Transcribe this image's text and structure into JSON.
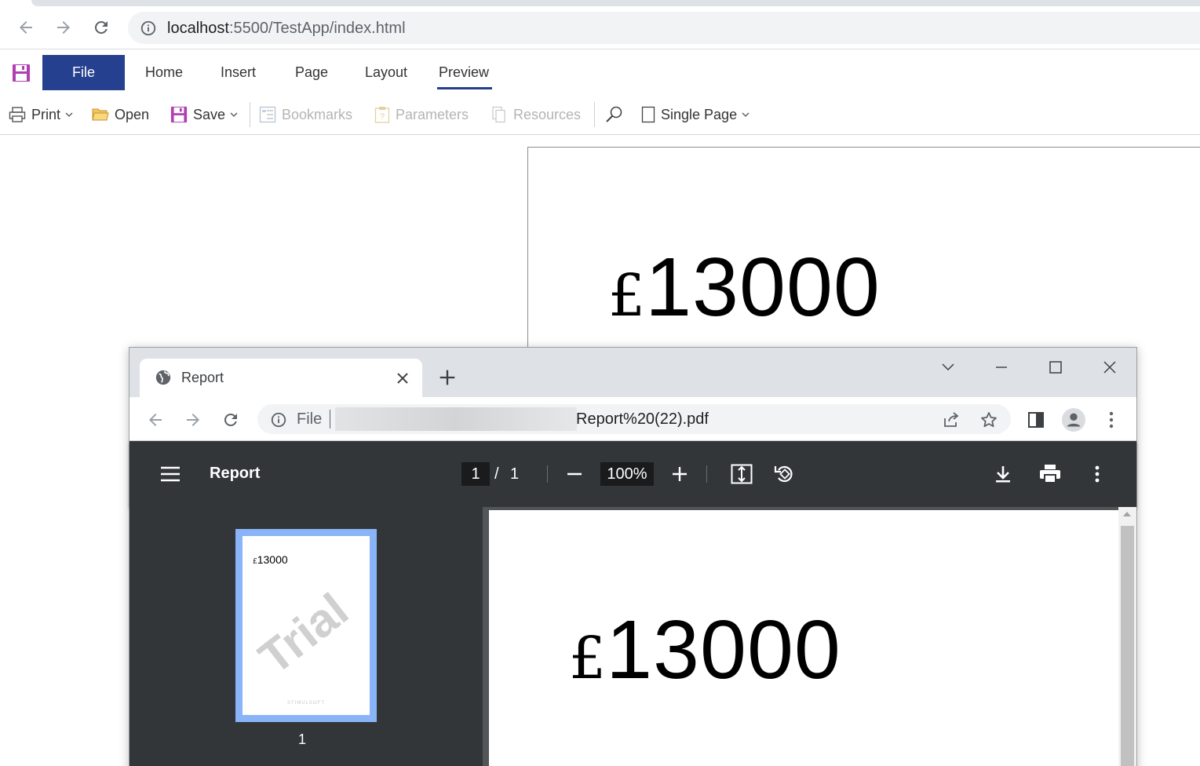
{
  "browser": {
    "url_host": "localhost",
    "url_rest": ":5500/TestApp/index.html",
    "icons": {
      "back": "back-arrow-icon",
      "forward": "forward-arrow-icon",
      "reload": "reload-icon",
      "info": "info-icon"
    }
  },
  "ribbon": {
    "tabs": [
      {
        "label": "File",
        "active": false
      },
      {
        "label": "Home"
      },
      {
        "label": "Insert"
      },
      {
        "label": "Page"
      },
      {
        "label": "Layout"
      },
      {
        "label": "Preview",
        "selected": true
      }
    ],
    "accent_color": "#25408f",
    "toolbar": {
      "print": "Print",
      "open": "Open",
      "save": "Save",
      "bookmarks": "Bookmarks",
      "parameters": "Parameters",
      "resources": "Resources",
      "view_mode": "Single Page"
    }
  },
  "report": {
    "currency": "£",
    "value": "13000"
  },
  "popup": {
    "tab_title": "Report",
    "omnibox_label": "File",
    "url_visible": "Report%20(22).pdf",
    "pdf": {
      "title": "Report",
      "current_page": "1",
      "separator": "/",
      "total_pages": "1",
      "zoom": "100%",
      "thumbnail": {
        "page_number": "1",
        "currency": "£",
        "value": "13000",
        "watermark": "Trial",
        "footer": "STIMULSOFT"
      }
    }
  }
}
